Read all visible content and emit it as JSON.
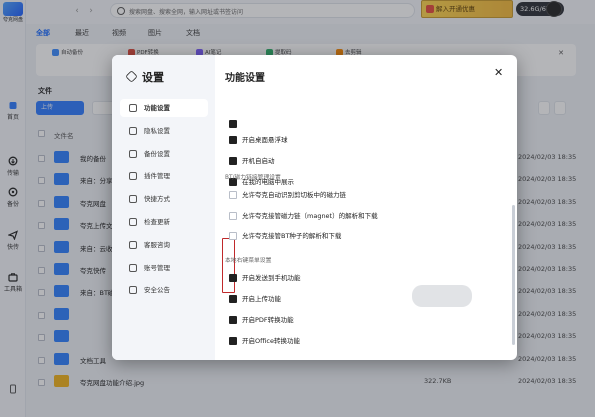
{
  "app": {
    "logo_text": "夸克网盘"
  },
  "rail": [
    {
      "label": "首页",
      "icon": "home-icon"
    },
    {
      "label": "传输",
      "icon": "transfer-icon"
    },
    {
      "label": "备份",
      "icon": "backup-icon"
    },
    {
      "label": "快传",
      "icon": "quick-send-icon"
    },
    {
      "label": "工具箱",
      "icon": "toolbox-icon"
    }
  ],
  "search": {
    "placeholder": "搜索网盘、搜索全网，输入网址或书签访问"
  },
  "vip": {
    "label": "解入开通优惠"
  },
  "quota": {
    "label": "32.6G/6T"
  },
  "tabs": [
    "全部",
    "最近",
    "视频",
    "图片",
    "文档"
  ],
  "quick": [
    {
      "label": "自动备份",
      "color": "#3c8dff"
    },
    {
      "label": "PDF转换",
      "color": "#e04a3c"
    },
    {
      "label": "AI笔记",
      "color": "#7b5cff"
    },
    {
      "label": "提取码",
      "color": "#2fb36b"
    },
    {
      "label": "去剪辑",
      "color": "#ff8a00"
    }
  ],
  "file_section": {
    "title": "文件",
    "upload_label": "上传",
    "col_name": "文件名"
  },
  "files": [
    {
      "name": "我的备份",
      "size": "",
      "date": "2024/02/03 18:35"
    },
    {
      "name": "来自：分享",
      "size": "",
      "date": "2024/02/03 18:35"
    },
    {
      "name": "夸克网盘",
      "size": "",
      "date": "2024/02/03 18:35"
    },
    {
      "name": "夸克上传文件",
      "size": "",
      "date": "2024/02/03 18:35"
    },
    {
      "name": "来自：云收藏",
      "size": "",
      "date": "2024/02/03 18:35"
    },
    {
      "name": "夸克快传",
      "size": "",
      "date": "2024/02/03 18:35"
    },
    {
      "name": "来自：BT磁力",
      "size": "",
      "date": "2024/02/03 18:35"
    },
    {
      "name": "",
      "size": "",
      "date": "2024/02/03 18:35"
    },
    {
      "name": "",
      "size": "",
      "date": "2024/02/03 18:35"
    },
    {
      "name": "文档工具",
      "size": "",
      "date": "2024/02/03 18:35"
    },
    {
      "name": "夸克网盘功能介绍.jpg",
      "size": "322.7KB",
      "date": "2024/02/03 18:35"
    }
  ],
  "modal": {
    "title": "设置",
    "main_title": "功能设置",
    "side": [
      {
        "label": "功能设置",
        "active": true
      },
      {
        "label": "隐私设置",
        "active": false
      },
      {
        "label": "备份设置",
        "active": false
      },
      {
        "label": "插件管理",
        "active": false
      },
      {
        "label": "快捷方式",
        "active": false
      },
      {
        "label": "检查更新",
        "active": false
      },
      {
        "label": "客服咨询",
        "active": false
      },
      {
        "label": "账号管理",
        "active": false
      },
      {
        "label": "安全公告",
        "active": false
      }
    ],
    "opts_top": [
      {
        "label": "开启桌面悬浮球",
        "checked": true
      },
      {
        "label": "开机自启动",
        "checked": true
      },
      {
        "label": "在我的电脑中展示",
        "checked": true
      }
    ],
    "group_bt": "BT/磁力链接管理设置",
    "opts_bt": [
      {
        "label": "允许夸克自动识别剪切板中的磁力链",
        "checked": false
      },
      {
        "label": "允许夸克接管磁力链（magnet）的解析和下载",
        "checked": false
      },
      {
        "label": "允许夸克接管BT种子的解析和下载",
        "checked": false
      }
    ],
    "group_ctx": "本地右键菜单设置",
    "opts_ctx": [
      {
        "label": "开启发送到手机功能",
        "checked": true
      },
      {
        "label": "开启上传功能",
        "checked": true
      },
      {
        "label": "开启PDF转换功能",
        "checked": true
      },
      {
        "label": "开启Office转换功能",
        "checked": true
      }
    ]
  }
}
